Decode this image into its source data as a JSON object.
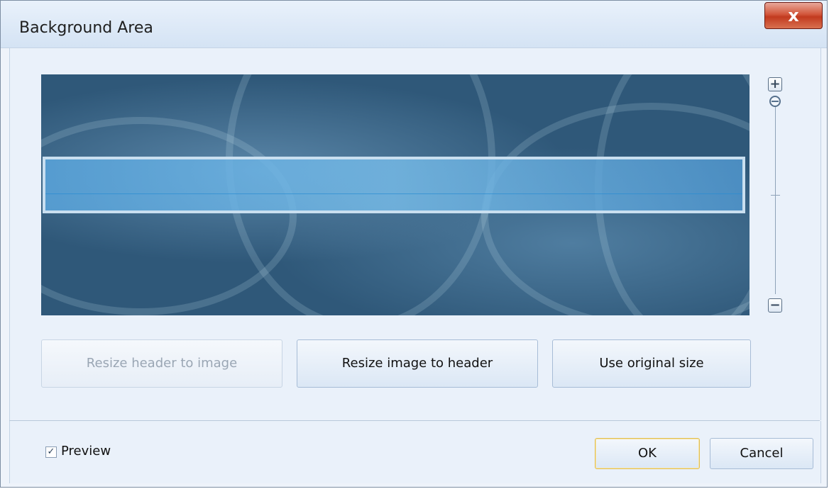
{
  "window": {
    "title": "Background Area",
    "close_icon": "close-icon",
    "close_glyph": "x"
  },
  "zoom": {
    "plus_icon": "plus-icon",
    "plus_glyph": "+",
    "minus_icon": "minus-icon",
    "minus_glyph": "−"
  },
  "actions": {
    "resize_header_to_image": "Resize header to image",
    "resize_image_to_header": "Resize image to header",
    "use_original_size": "Use original size"
  },
  "footer": {
    "preview_label": "Preview",
    "preview_checked": true,
    "check_glyph": "✓",
    "ok_label": "OK",
    "cancel_label": "Cancel"
  },
  "colors": {
    "image_base": "#2f5879",
    "header_band": "#6fb4e4",
    "close_button": "#c94a2c",
    "ok_focus": "#e1bf55"
  }
}
